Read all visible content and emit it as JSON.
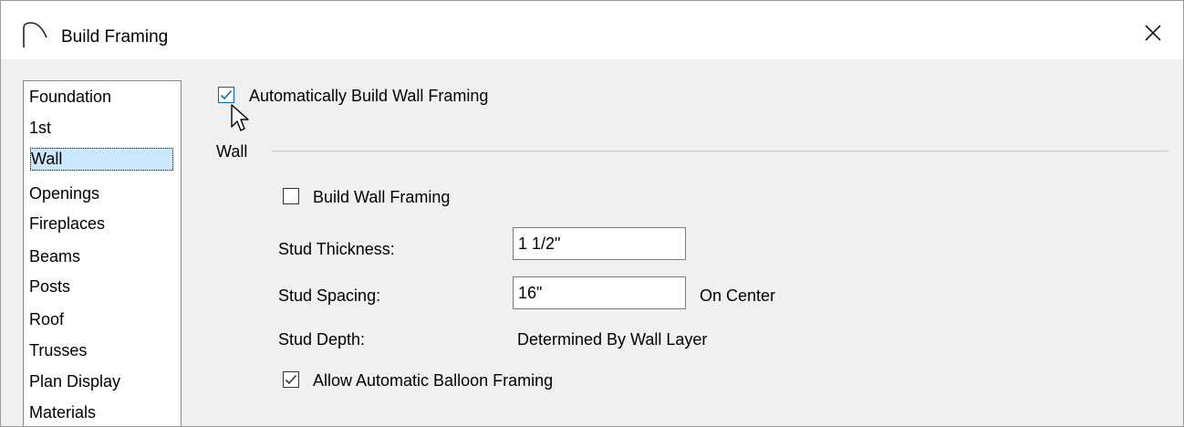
{
  "window": {
    "title": "Build Framing",
    "app_icon": "arch-icon",
    "close_icon": "close-icon"
  },
  "sidebar": {
    "items": [
      {
        "label": "Foundation"
      },
      {
        "label": "1st"
      },
      {
        "label": "Wall",
        "selected": true
      },
      {
        "label": "Openings"
      },
      {
        "label": "Fireplaces"
      },
      {
        "label": "Beams"
      },
      {
        "label": "Posts"
      },
      {
        "label": "Roof"
      },
      {
        "label": "Trusses"
      },
      {
        "label": "Plan Display"
      },
      {
        "label": "Materials"
      }
    ]
  },
  "main": {
    "auto_build": {
      "label": "Automatically Build Wall Framing",
      "checked": true
    },
    "group_title": "Wall",
    "build_wall_framing": {
      "label": "Build Wall Framing",
      "checked": false
    },
    "stud_thickness": {
      "label": "Stud Thickness:",
      "value": "1 1/2\""
    },
    "stud_spacing": {
      "label": "Stud Spacing:",
      "value": "16\"",
      "suffix": "On Center"
    },
    "stud_depth": {
      "label": "Stud Depth:",
      "value": "Determined By Wall Layer"
    },
    "balloon": {
      "label": "Allow Automatic Balloon Framing",
      "checked": true
    }
  },
  "colors": {
    "selection": "#cce8ff",
    "check_accent": "#0067c0",
    "dialog_bg": "#f0f0f0"
  }
}
